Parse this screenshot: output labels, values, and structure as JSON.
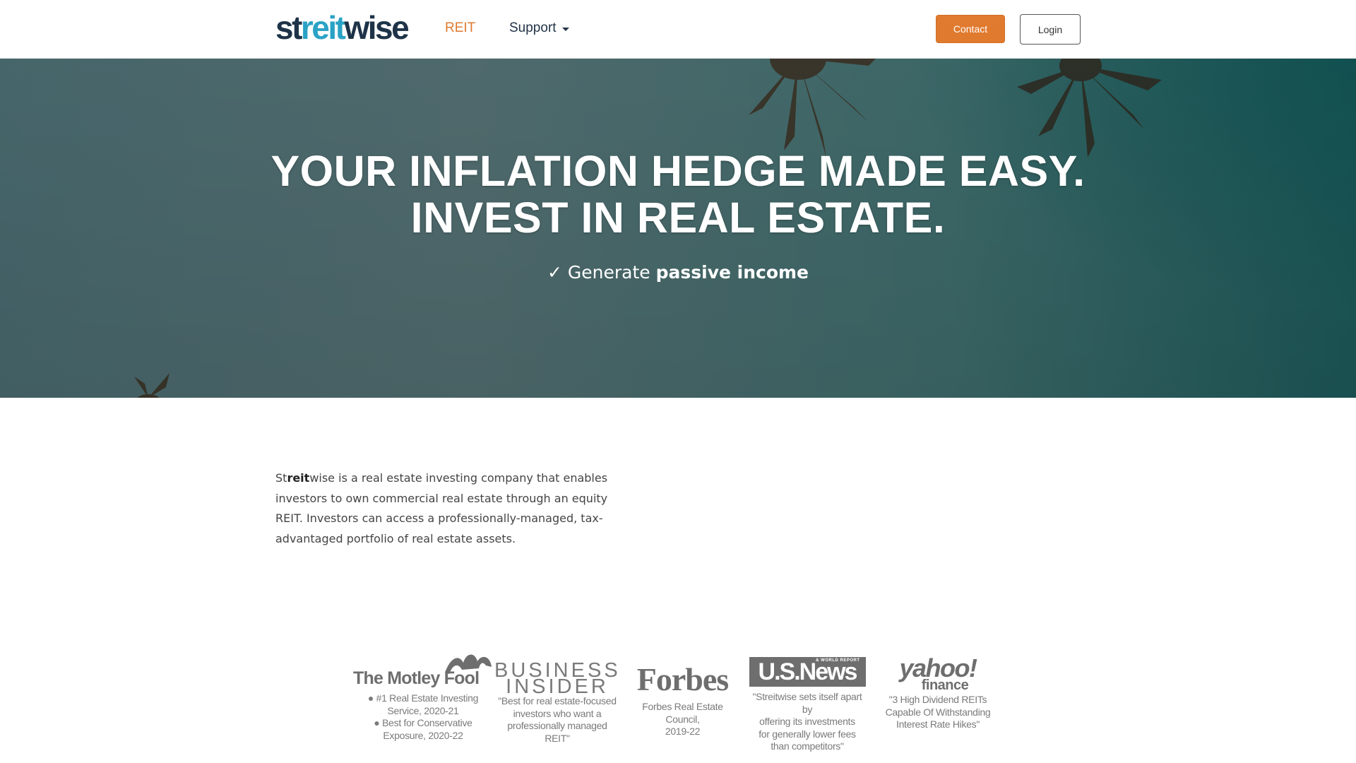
{
  "brand": {
    "logo_a": "st",
    "logo_b": "reit",
    "logo_c": "wise",
    "colors": {
      "navy": "#1e3348",
      "teal": "#2aa2c6",
      "orange": "#e07a2e"
    }
  },
  "nav": {
    "reit_label": "REIT",
    "support_label": "Support",
    "contact_label": "Contact",
    "login_label": "Login"
  },
  "hero": {
    "title_line1": "YOUR INFLATION HEDGE MADE EASY.",
    "title_line2": "INVEST IN REAL ESTATE.",
    "check_glyph": "✓",
    "sub_light": "Generate",
    "sub_bold": "passive income"
  },
  "about": {
    "brand_pre": "St",
    "brand_bold": "reit",
    "brand_post": "wise",
    "text": " is a real estate investing company that enables investors to own commercial real estate through an equity REIT. Investors can access a professionally-managed, tax-advantaged portfolio of real estate assets."
  },
  "press": {
    "motley": {
      "logo": "The Motley Fool",
      "line1": "● #1 Real Estate Investing",
      "line2": "Service, 2020-21",
      "line3": "● Best for Conservative",
      "line4": "Exposure, 2020-22"
    },
    "business_insider": {
      "logo_line1": "BUSINESS",
      "logo_line2": "INSIDER",
      "line1": "\"Best for real estate-focused",
      "line2": "investors who want a",
      "line3": "professionally managed REIT\""
    },
    "forbes": {
      "logo": "Forbes",
      "line1": "Forbes Real Estate Council,",
      "line2": "2019-22"
    },
    "usnews": {
      "logo": "U.S.News",
      "logo_small": "& WORLD REPORT",
      "line1": "\"Streitwise sets itself apart by",
      "line2": "offering its investments",
      "line3": "for generally lower fees",
      "line4": "than competitors\""
    },
    "yahoo": {
      "logo": "yahoo!",
      "logo_sub": "finance",
      "line1": "\"3 High Dividend REITs",
      "line2": "Capable Of Withstanding",
      "line3": "Interest Rate Hikes\""
    }
  }
}
